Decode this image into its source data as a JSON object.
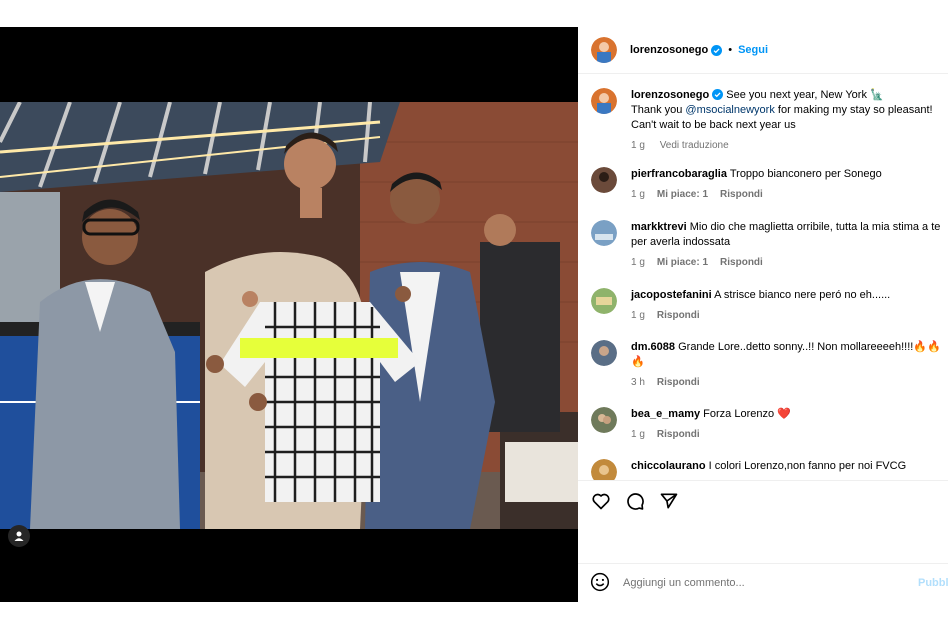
{
  "post": {
    "username": "lorenzosonego",
    "follow_label": "Segui",
    "separator": "•"
  },
  "caption": {
    "username": "lorenzosonego",
    "line1": "See you next year, New York 🗽",
    "thanks_prefix": "Thank you ",
    "mention": "@msocialnewyork",
    "thanks_suffix": " for making my stay so pleasant! Can't wait to be back next year us",
    "time": "1 g",
    "see_translation": "Vedi traduzione"
  },
  "comments": [
    {
      "username": "pierfrancobaraglia",
      "text": "Troppo bianconero per Sonego",
      "time": "1 g",
      "likes": "Mi piace: 1",
      "reply": "Rispondi",
      "avatar_color": "#6b4a3a"
    },
    {
      "username": "markktrevi",
      "text": "Mio dio che maglietta orribile, tutta la mia stima a te per averla indossata",
      "time": "1 g",
      "likes": "Mi piace: 1",
      "reply": "Rispondi",
      "avatar_color": "#7aa0c4"
    },
    {
      "username": "jacopostefanini",
      "text": "A strisce bianco nere peró no eh......",
      "time": "1 g",
      "likes": "",
      "reply": "Rispondi",
      "avatar_color": "#8fb36b"
    },
    {
      "username": "dm.6088",
      "text": "Grande Lore..detto sonny..!! Non mollareeeeh!!!!🔥🔥🔥",
      "time": "3 h",
      "likes": "",
      "reply": "Rispondi",
      "avatar_color": "#5a6e86"
    },
    {
      "username": "bea_e_mamy",
      "text": "Forza Lorenzo ❤️",
      "time": "1 g",
      "likes": "",
      "reply": "Rispondi",
      "avatar_color": "#6f7a5b"
    },
    {
      "username": "chiccolaurano",
      "text": "I colori Lorenzo,non fanno per noi FVCG",
      "time": "",
      "likes": "",
      "reply": "",
      "avatar_color": "#c28a3c"
    }
  ],
  "add_comment": {
    "placeholder": "Aggiungi un commento...",
    "publish": "Pubblica"
  },
  "colors": {
    "link": "#0095f6",
    "mention": "#00376b",
    "muted": "#737373",
    "verified": "#0095f6"
  }
}
